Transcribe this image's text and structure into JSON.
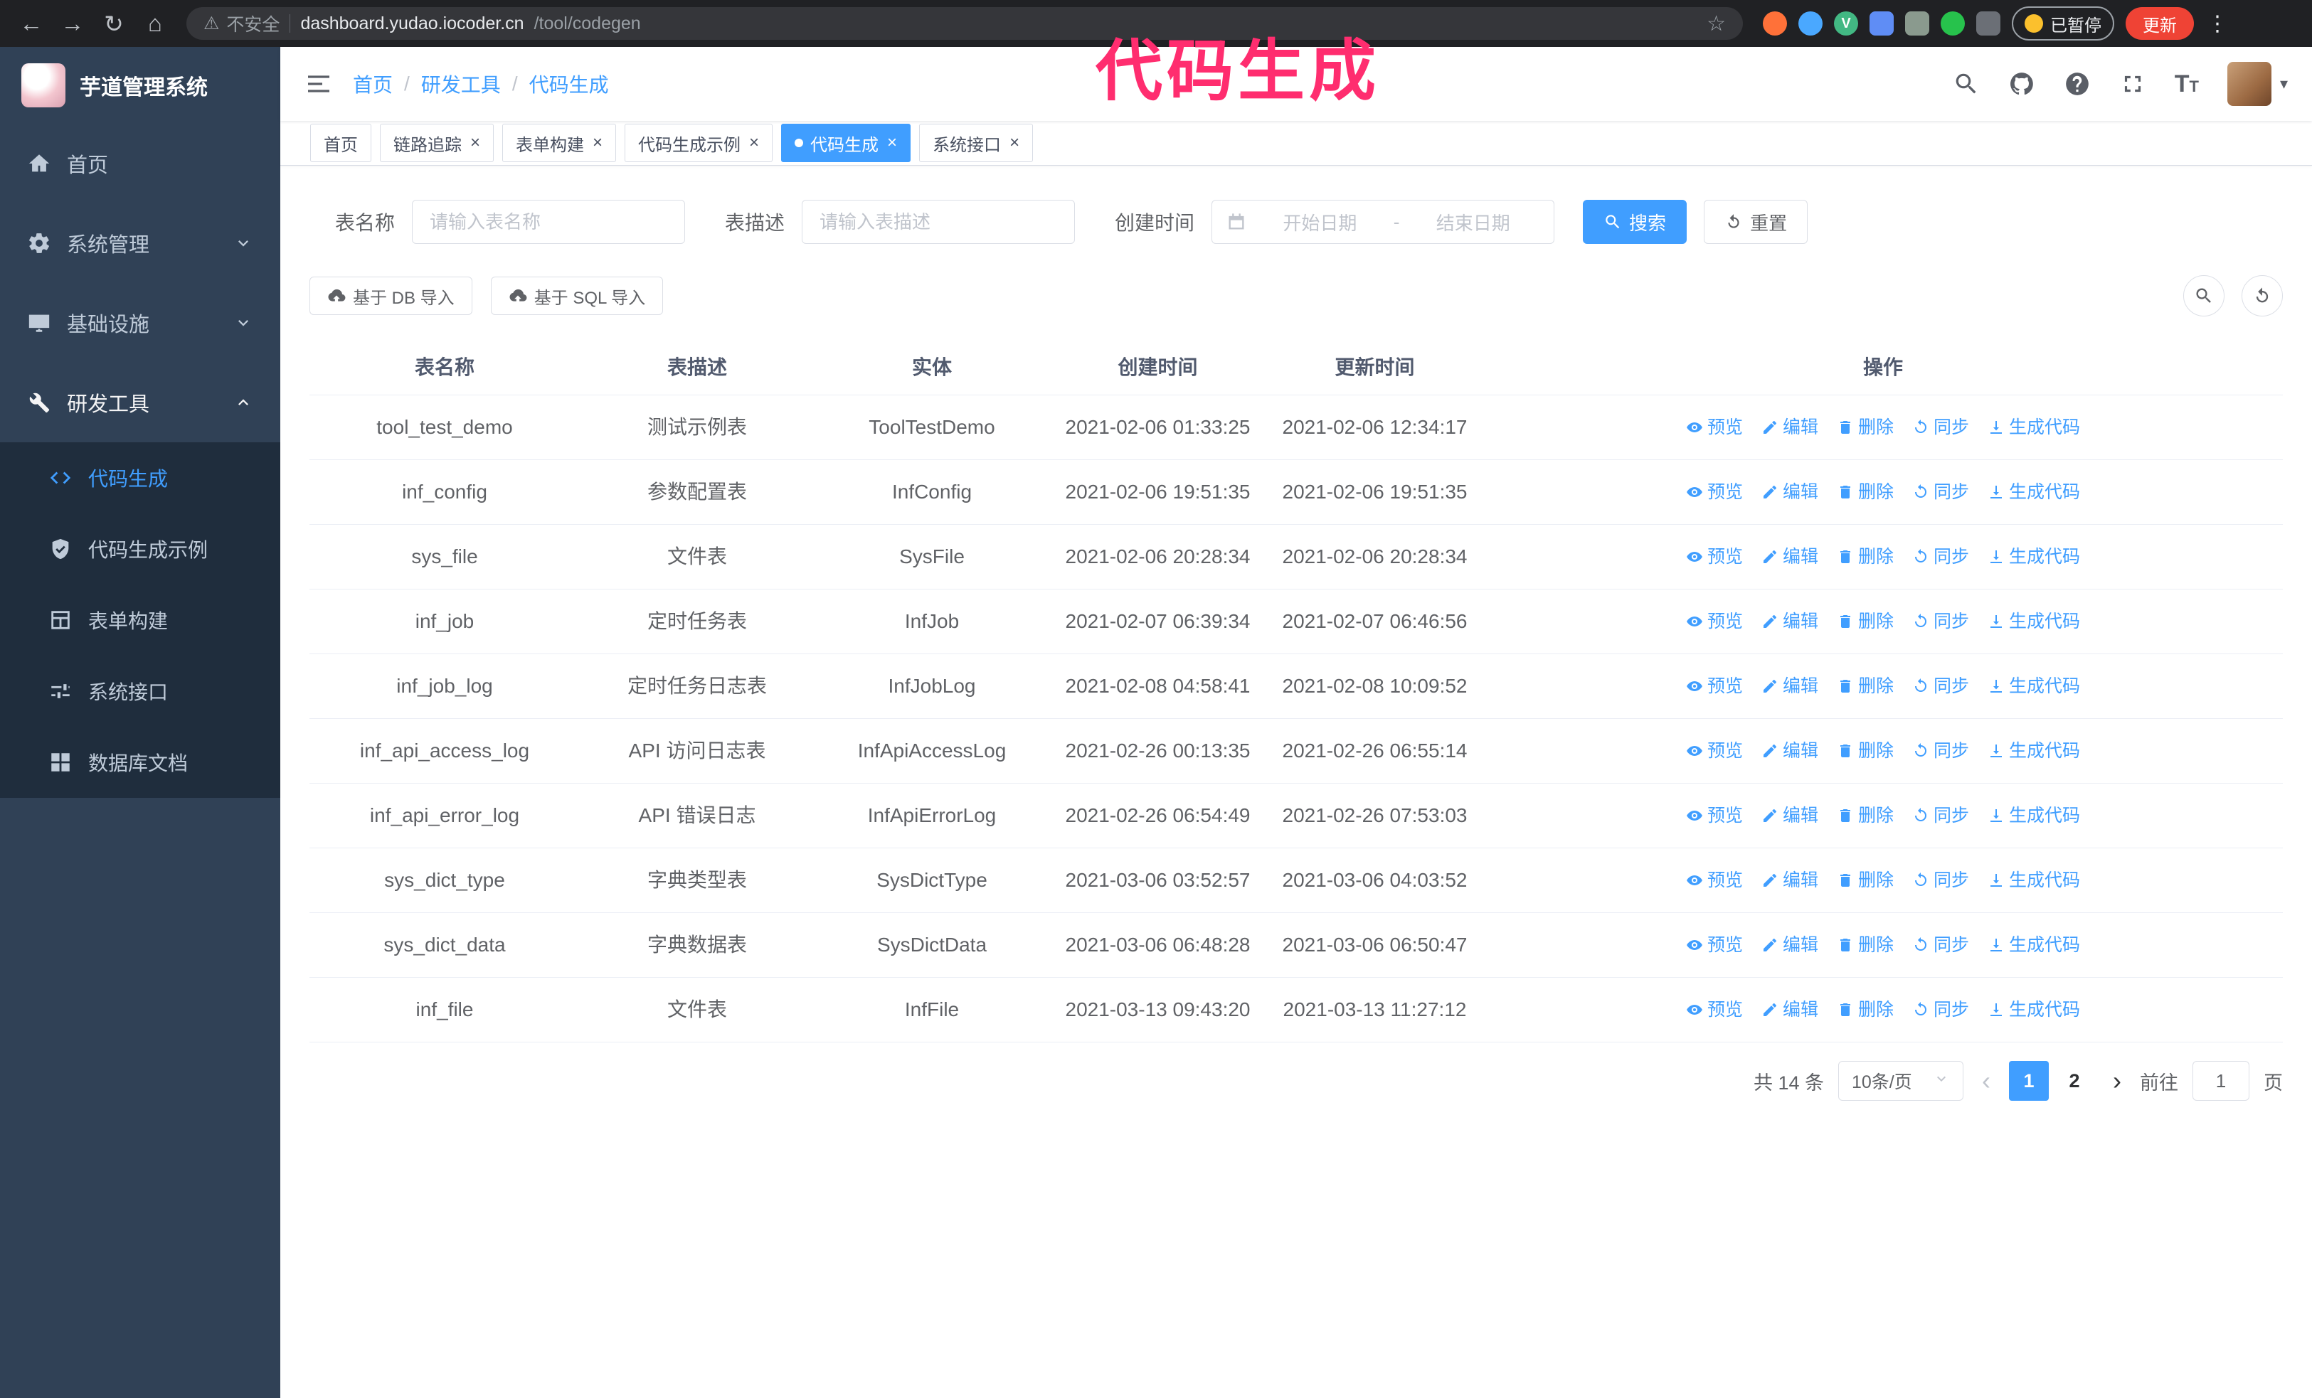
{
  "browser": {
    "nav_icons": [
      "back",
      "forward",
      "reload",
      "home"
    ],
    "security_warning": "不安全",
    "url_host": "dashboard.yudao.iocoder.cn",
    "url_path": "/tool/codegen",
    "extensions": [
      "fox",
      "drop",
      "vue",
      "people",
      "camera",
      "leaf",
      "puzzle"
    ],
    "paused_badge": "已暂停",
    "update_button": "更新"
  },
  "annotation": {
    "text": "代码生成"
  },
  "sidebar": {
    "title": "芋道管理系统",
    "menu": [
      {
        "label": "首页",
        "name": "home",
        "icon": "home",
        "type": "item",
        "state": "none"
      },
      {
        "label": "系统管理",
        "name": "system-management",
        "icon": "gear",
        "type": "group",
        "state": "collapsed"
      },
      {
        "label": "基础设施",
        "name": "infrastructure",
        "icon": "monitor",
        "type": "group",
        "state": "collapsed"
      },
      {
        "label": "研发工具",
        "name": "dev-tools",
        "icon": "wrench",
        "type": "group",
        "state": "expanded"
      }
    ],
    "submenu": [
      {
        "label": "代码生成",
        "name": "codegen",
        "icon": "code",
        "active": true
      },
      {
        "label": "代码生成示例",
        "name": "codegen-example",
        "icon": "badge",
        "active": false
      },
      {
        "label": "表单构建",
        "name": "form-builder",
        "icon": "form",
        "active": false
      },
      {
        "label": "系统接口",
        "name": "system-api",
        "icon": "sliders",
        "active": false
      },
      {
        "label": "数据库文档",
        "name": "db-doc",
        "icon": "grid",
        "active": false
      }
    ]
  },
  "header": {
    "breadcrumb": [
      "首页",
      "研发工具",
      "代码生成"
    ],
    "icons": [
      "search",
      "github",
      "question",
      "fullscreen",
      "fontsize"
    ]
  },
  "tabs": [
    {
      "label": "首页",
      "name": "home",
      "closable": false,
      "active": false
    },
    {
      "label": "链路追踪",
      "name": "tracing",
      "closable": true,
      "active": false
    },
    {
      "label": "表单构建",
      "name": "form-builder",
      "closable": true,
      "active": false
    },
    {
      "label": "代码生成示例",
      "name": "codegen-example",
      "closable": true,
      "active": false
    },
    {
      "label": "代码生成",
      "name": "codegen",
      "closable": true,
      "active": true
    },
    {
      "label": "系统接口",
      "name": "system-api",
      "closable": true,
      "active": false
    }
  ],
  "filters": {
    "table_name_label": "表名称",
    "table_name_placeholder": "请输入表名称",
    "table_desc_label": "表描述",
    "table_desc_placeholder": "请输入表描述",
    "create_time_label": "创建时间",
    "start_date_placeholder": "开始日期",
    "range_separator": "-",
    "end_date_placeholder": "结束日期",
    "search_button": "搜索",
    "reset_button": "重置"
  },
  "toolbar": {
    "import_db_button": "基于 DB 导入",
    "import_sql_button": "基于 SQL 导入"
  },
  "table": {
    "columns": [
      "表名称",
      "表描述",
      "实体",
      "创建时间",
      "更新时间",
      "操作"
    ],
    "actions": [
      {
        "label": "预览",
        "name": "preview",
        "icon": "eye"
      },
      {
        "label": "编辑",
        "name": "edit",
        "icon": "edit"
      },
      {
        "label": "删除",
        "name": "delete",
        "icon": "trash"
      },
      {
        "label": "同步",
        "name": "sync",
        "icon": "sync"
      },
      {
        "label": "生成代码",
        "name": "generate-code",
        "icon": "download"
      }
    ],
    "rows": [
      {
        "name": "tool_test_demo",
        "desc": "测试示例表",
        "entity": "ToolTestDemo",
        "created": "2021-02-06 01:33:25",
        "updated": "2021-02-06 12:34:17"
      },
      {
        "name": "inf_config",
        "desc": "参数配置表",
        "entity": "InfConfig",
        "created": "2021-02-06 19:51:35",
        "updated": "2021-02-06 19:51:35"
      },
      {
        "name": "sys_file",
        "desc": "文件表",
        "entity": "SysFile",
        "created": "2021-02-06 20:28:34",
        "updated": "2021-02-06 20:28:34"
      },
      {
        "name": "inf_job",
        "desc": "定时任务表",
        "entity": "InfJob",
        "created": "2021-02-07 06:39:34",
        "updated": "2021-02-07 06:46:56"
      },
      {
        "name": "inf_job_log",
        "desc": "定时任务日志表",
        "entity": "InfJobLog",
        "created": "2021-02-08 04:58:41",
        "updated": "2021-02-08 10:09:52"
      },
      {
        "name": "inf_api_access_log",
        "desc": "API 访问日志表",
        "entity": "InfApiAccessLog",
        "created": "2021-02-26 00:13:35",
        "updated": "2021-02-26 06:55:14"
      },
      {
        "name": "inf_api_error_log",
        "desc": "API 错误日志",
        "entity": "InfApiErrorLog",
        "created": "2021-02-26 06:54:49",
        "updated": "2021-02-26 07:53:03"
      },
      {
        "name": "sys_dict_type",
        "desc": "字典类型表",
        "entity": "SysDictType",
        "created": "2021-03-06 03:52:57",
        "updated": "2021-03-06 04:03:52"
      },
      {
        "name": "sys_dict_data",
        "desc": "字典数据表",
        "entity": "SysDictData",
        "created": "2021-03-06 06:48:28",
        "updated": "2021-03-06 06:50:47"
      },
      {
        "name": "inf_file",
        "desc": "文件表",
        "entity": "InfFile",
        "created": "2021-03-13 09:43:20",
        "updated": "2021-03-13 11:27:12"
      }
    ]
  },
  "pagination": {
    "total_label": "共 14 条",
    "page_size": "10条/页",
    "pages": [
      "1",
      "2"
    ],
    "active_page": "1",
    "goto_prefix": "前往",
    "goto_value": "1",
    "goto_suffix": "页"
  }
}
